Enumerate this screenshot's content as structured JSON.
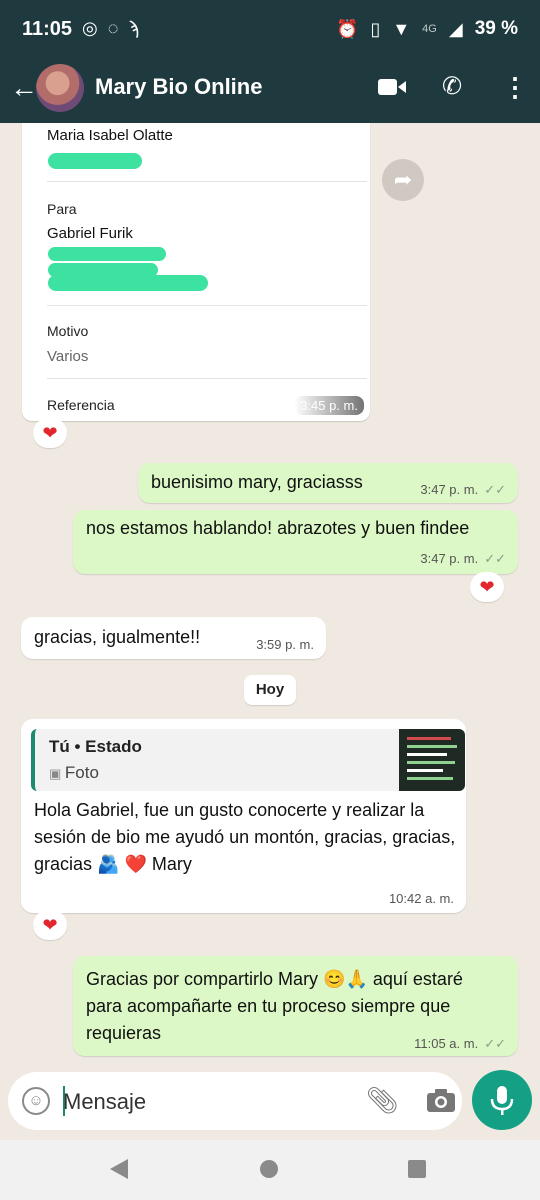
{
  "status": {
    "time": "11:05",
    "network": "4G",
    "battery": "39 %"
  },
  "header": {
    "contact_name": "Mary Bio Online",
    "back_icon": "arrow-left-icon",
    "video_icon": "video-call-icon",
    "phone_icon": "voice-call-icon",
    "menu_icon": "more-vertical-icon"
  },
  "transfer_card": {
    "from_name": "Maria Isabel Olatte",
    "to_label": "Para",
    "to_name": "Gabriel Furik",
    "reason_label": "Motivo",
    "reason_value": "Varios",
    "reference_label": "Referencia",
    "time": "3:45 p. m.",
    "reaction": "❤"
  },
  "messages": [
    {
      "id": "m1",
      "text": "buenisimo mary, graciasss",
      "time": "3:47 p. m.",
      "ticks": "✓✓"
    },
    {
      "id": "m2",
      "text": "nos estamos hablando! abrazotes y buen findee",
      "time": "3:47 p. m.",
      "ticks": "✓✓",
      "reaction": "❤"
    },
    {
      "id": "m3",
      "text": "gracias, igualmente!!",
      "time": "3:59 p. m."
    },
    {
      "id": "m4",
      "quote_title": "Tú • Estado",
      "quote_sub": "Foto",
      "text": "Hola Gabriel, fue un gusto conocerte y realizar la sesión de bio me ayudó un montón, gracias, gracias, gracias 🫂 ❤️ Mary",
      "time": "10:42 a. m.",
      "reaction": "❤"
    },
    {
      "id": "m5",
      "text": "Gracias por compartirlo Mary 😊🙏 aquí estaré para acompañarte en tu proceso siempre que requieras",
      "time": "11:05 a. m.",
      "ticks": "✓✓"
    }
  ],
  "day_divider": "Hoy",
  "composer": {
    "placeholder": "Mensaje",
    "emoji_icon": "emoji-icon",
    "attach_icon": "paperclip-icon",
    "camera_icon": "camera-icon",
    "mic_icon": "mic-icon"
  },
  "colors": {
    "header": "#1f3a3f",
    "outgoing": "#dcf8c6",
    "incoming": "#ffffff",
    "accent": "#14a085",
    "heart": "#e2262e"
  }
}
